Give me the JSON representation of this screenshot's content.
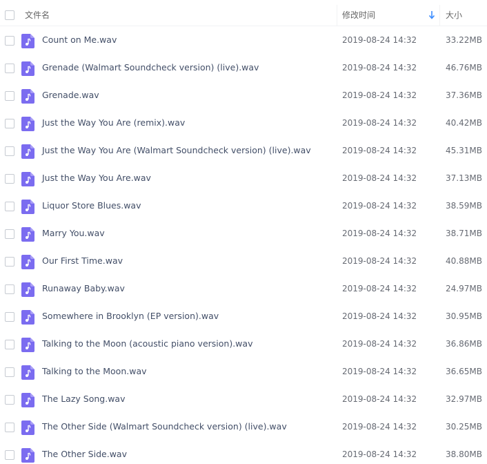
{
  "header": {
    "name_label": "文件名",
    "mtime_label": "修改时间",
    "size_label": "大小",
    "sort_icon": "arrow-down-icon",
    "sort_color": "#3b8cff"
  },
  "file_icon": "music-file-icon",
  "file_icon_color": "#7b6cf0",
  "files": [
    {
      "name": "Count on Me.wav",
      "mtime": "2019-08-24 14:32",
      "size": "33.22MB"
    },
    {
      "name": "Grenade (Walmart Soundcheck version) (live).wav",
      "mtime": "2019-08-24 14:32",
      "size": "46.76MB"
    },
    {
      "name": "Grenade.wav",
      "mtime": "2019-08-24 14:32",
      "size": "37.36MB"
    },
    {
      "name": "Just the Way You Are (remix).wav",
      "mtime": "2019-08-24 14:32",
      "size": "40.42MB"
    },
    {
      "name": "Just the Way You Are (Walmart Soundcheck version) (live).wav",
      "mtime": "2019-08-24 14:32",
      "size": "45.31MB"
    },
    {
      "name": "Just the Way You Are.wav",
      "mtime": "2019-08-24 14:32",
      "size": "37.13MB"
    },
    {
      "name": "Liquor Store Blues.wav",
      "mtime": "2019-08-24 14:32",
      "size": "38.59MB"
    },
    {
      "name": "Marry You.wav",
      "mtime": "2019-08-24 14:32",
      "size": "38.71MB"
    },
    {
      "name": "Our First Time.wav",
      "mtime": "2019-08-24 14:32",
      "size": "40.88MB"
    },
    {
      "name": "Runaway Baby.wav",
      "mtime": "2019-08-24 14:32",
      "size": "24.97MB"
    },
    {
      "name": "Somewhere in Brooklyn (EP version).wav",
      "mtime": "2019-08-24 14:32",
      "size": "30.95MB"
    },
    {
      "name": "Talking to the Moon (acoustic piano version).wav",
      "mtime": "2019-08-24 14:32",
      "size": "36.86MB"
    },
    {
      "name": "Talking to the Moon.wav",
      "mtime": "2019-08-24 14:32",
      "size": "36.65MB"
    },
    {
      "name": "The Lazy Song.wav",
      "mtime": "2019-08-24 14:32",
      "size": "32.97MB"
    },
    {
      "name": "The Other Side (Walmart Soundcheck version) (live).wav",
      "mtime": "2019-08-24 14:32",
      "size": "30.25MB"
    },
    {
      "name": "The Other Side.wav",
      "mtime": "2019-08-24 14:32",
      "size": "38.80MB"
    }
  ]
}
